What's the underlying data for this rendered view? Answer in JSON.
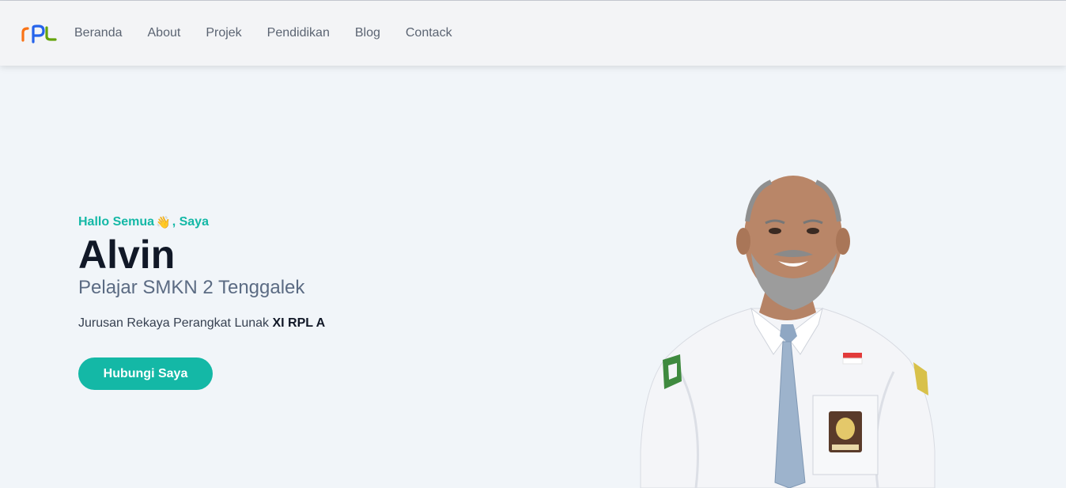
{
  "nav": {
    "items": [
      {
        "label": "Beranda"
      },
      {
        "label": "About"
      },
      {
        "label": "Projek"
      },
      {
        "label": "Pendidikan"
      },
      {
        "label": "Blog"
      },
      {
        "label": "Contack"
      }
    ]
  },
  "hero": {
    "greeting": "Hallo Semua",
    "greeting_emoji": "👋",
    "greeting_suffix": ", Saya",
    "name": "Alvin",
    "role": "Pelajar SMKN 2 Tenggalek",
    "description": "Jurusan Rekaya Perangkat Lunak ",
    "class_name": "XI RPL A",
    "cta_label": "Hubungi Saya"
  },
  "colors": {
    "accent": "#14b8a6",
    "background": "#f1f5f9",
    "header": "#f3f4f6",
    "logo_orange": "#f97316",
    "logo_blue": "#2563eb",
    "logo_green": "#65a30d"
  },
  "icons": {
    "logo": "rpl-logo"
  }
}
